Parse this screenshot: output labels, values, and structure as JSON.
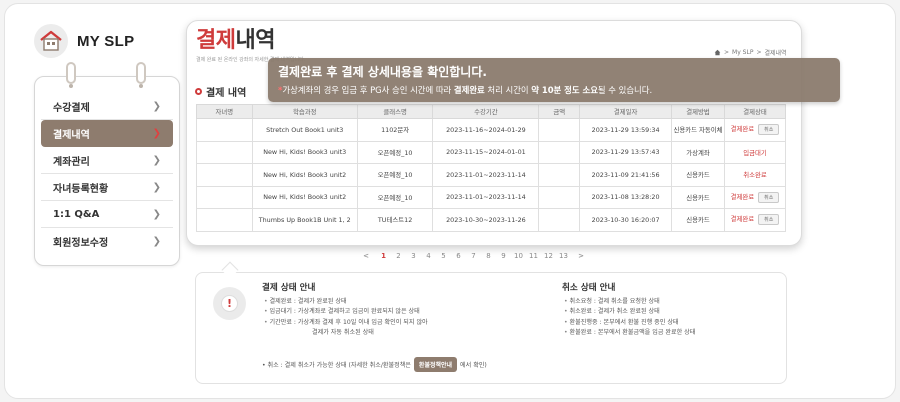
{
  "app": {
    "logo_text": "MY SLP"
  },
  "sidebar": {
    "items": [
      {
        "label": "수강결제",
        "active": false
      },
      {
        "label": "결제내역",
        "active": true
      },
      {
        "label": "계좌관리",
        "active": false
      },
      {
        "label": "자녀등록현황",
        "active": false
      },
      {
        "label": "1:1 Q&A",
        "active": false
      },
      {
        "label": "회원정보수정",
        "active": false
      }
    ]
  },
  "header": {
    "title_accent": "결제",
    "title_rest": "내역",
    "subtitle": "결제 완료 된 온라인 강좌의 자세한 결제 내역입니다.",
    "breadcrumb": [
      "My SLP",
      "결제내역"
    ]
  },
  "section": {
    "label": "결제 내역"
  },
  "tooltip": {
    "line1": "결제완료 후 결제 상세내용을 확인합니다.",
    "line2_mark": "*",
    "line2_a": "가상계좌의 경우 입금 후 PG사 승인 시간에 따라 ",
    "line2_b": "결제완료",
    "line2_c": " 처리 시간이 ",
    "line2_d": "약 10분 정도 소요",
    "line2_e": "될 수 있습니다."
  },
  "table": {
    "headers": [
      "자녀명",
      "학습과정",
      "클래스명",
      "수강기간",
      "금액",
      "결제일자",
      "결제방법",
      "결제상태"
    ],
    "cancel_label": "취소",
    "rows": [
      {
        "child": "",
        "course": "Stretch Out Book1 unit3",
        "class": "1102문자",
        "period": "2023-11-16~2024-01-29",
        "amount": "",
        "date": "2023-11-29 13:59:34",
        "method": "신용카드 자동이체",
        "status": "결제완료",
        "cancel": true
      },
      {
        "child": "",
        "course": "New Hi, Kids! Book3 unit3",
        "class": "오픈예정_10",
        "period": "2023-11-15~2024-01-01",
        "amount": "",
        "date": "2023-11-29 13:57:43",
        "method": "가상계좌",
        "status": "입금대기",
        "cancel": false
      },
      {
        "child": "",
        "course": "New Hi, Kids! Book3 unit2",
        "class": "오픈예정_10",
        "period": "2023-11-01~2023-11-14",
        "amount": "",
        "date": "2023-11-09 21:41:56",
        "method": "신용카드",
        "status": "취소완료",
        "cancel": false
      },
      {
        "child": "",
        "course": "New Hi, Kids! Book3 unit2",
        "class": "오픈예정_10",
        "period": "2023-11-01~2023-11-14",
        "amount": "",
        "date": "2023-11-08 13:28:20",
        "method": "신용카드",
        "status": "결제완료",
        "cancel": true
      },
      {
        "child": "",
        "course": "Thumbs Up Book1B Unit 1, 2",
        "class": "TU테스트12",
        "period": "2023-10-30~2023-11-26",
        "amount": "",
        "date": "2023-10-30 16:20:07",
        "method": "신용카드",
        "status": "결제완료",
        "cancel": true
      }
    ]
  },
  "pagination": {
    "prev": "<",
    "next": ">",
    "pages": [
      "1",
      "2",
      "3",
      "4",
      "5",
      "6",
      "7",
      "8",
      "9",
      "10",
      "11",
      "12",
      "13"
    ],
    "current": "1"
  },
  "info": {
    "payment_title": "결제 상태 안내",
    "payment_items": [
      {
        "text": "결제완료 : 결제가 완료된 상태",
        "cont": false
      },
      {
        "text": "입금대기 : 가상계좌로 결제하고 입금이 완료되지 않은 상태",
        "cont": false
      },
      {
        "text": "기간만료 : 가상계좌 결제 후 10일 이내 입금 확인이 되지 않아",
        "cont": false
      },
      {
        "text": "결제가 자동 취소된 상태",
        "cont": true
      }
    ],
    "cancel_title": "취소 상태 안내",
    "cancel_items": [
      {
        "text": "취소요청 : 결제 취소를 요청한 상태"
      },
      {
        "text": "취소완료 : 결제가 취소 완료된 상태"
      },
      {
        "text": "환불진행중 : 본부에서 환불 진행 중인 상태"
      },
      {
        "text": "환불완료 : 본부에서 환불금액을 입금 완료한 상태"
      }
    ],
    "note_a": "• 취소 : 결제 취소가 가능한 상태 (자세한 취소/환불정책은",
    "note_button": "환불정책안내",
    "note_b": "에서 확인)"
  },
  "colors": {
    "accent": "#cf3b3b",
    "brand_brown": "#8e7c6e"
  }
}
